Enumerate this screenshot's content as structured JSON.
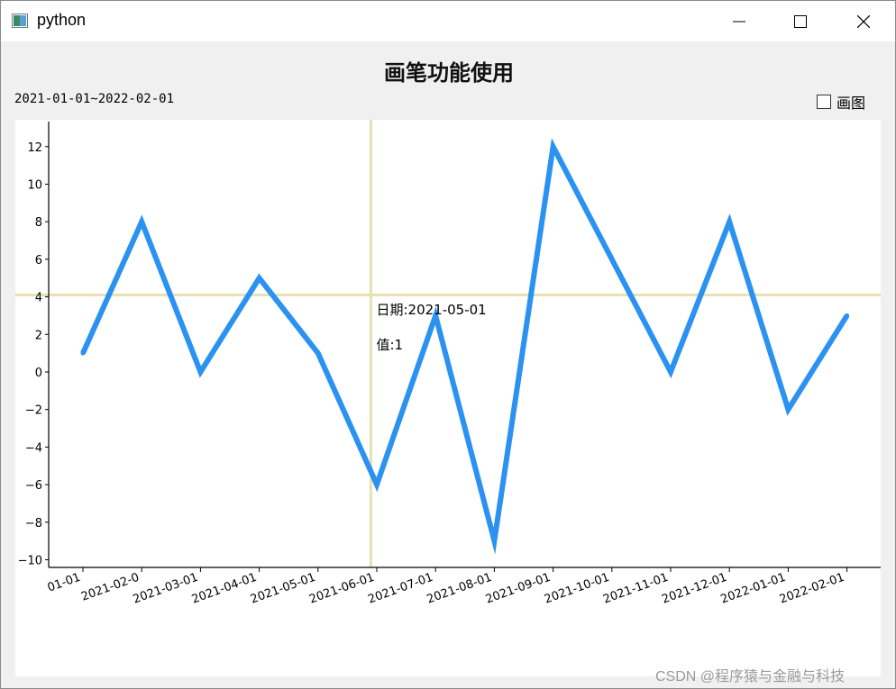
{
  "window": {
    "title": "python",
    "icon": "python-window-icon",
    "controls": [
      "minimize-icon",
      "maximize-icon",
      "close-icon"
    ]
  },
  "header": {
    "title": "画笔功能使用",
    "date_range": "2021-01-01~2022-02-01",
    "checkbox_label": "画图",
    "checkbox_checked": false
  },
  "tooltip": {
    "date_line": "日期:2021-05-01",
    "value_line": "值:1"
  },
  "colors": {
    "line": "#2b92f2",
    "crosshair": "#e6e2b4",
    "axis": "#000000"
  },
  "chart_data": {
    "type": "line",
    "x_tick_labels": [
      "01-01",
      "2021-02-0",
      "2021-03-01",
      "2021-04-01",
      "2021-05-01",
      "2021-06-01",
      "2021-07-01",
      "2021-08-01",
      "2021-09-01",
      "2021-10-01",
      "2021-11-01",
      "2021-12-01",
      "2022-01-01",
      "2022-02-01"
    ],
    "values": [
      1,
      8,
      0,
      5,
      1,
      -6,
      3,
      -9,
      12,
      6,
      0,
      8,
      -2,
      3
    ],
    "y_ticks": [
      12,
      10,
      8,
      6,
      4,
      2,
      0,
      -2,
      -4,
      -6,
      -8,
      -10
    ],
    "crosshair": {
      "x_index": 4.9,
      "y_value": 4.1
    },
    "grid": false,
    "ylim": [
      -10.4,
      13.2
    ]
  },
  "watermark": "CSDN @程序猿与金融与科技"
}
